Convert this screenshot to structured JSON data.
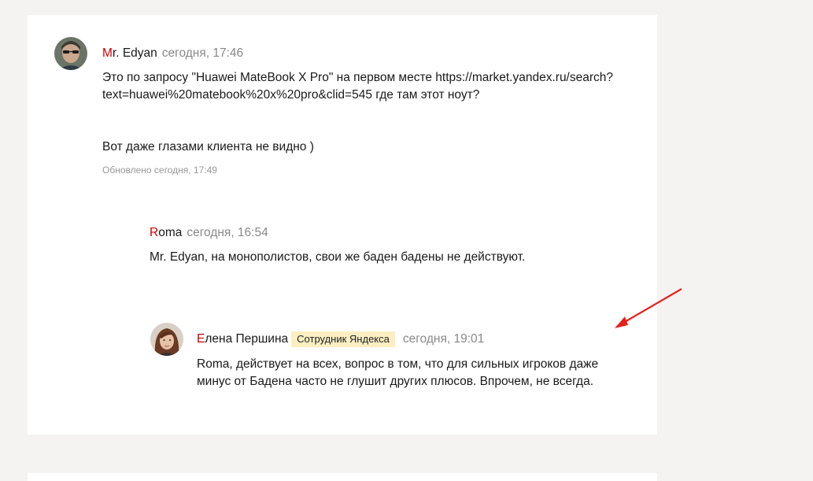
{
  "comments": [
    {
      "author_first": "M",
      "author_rest": "r. Edyan",
      "time": "сегодня, 17:46",
      "line1": "Это по запросу \"Huawei MateBook X Pro\" на первом месте https://market.yandex.ru/search?",
      "line2": "text=huawei%20matebook%20x%20pro&clid=545 где там этот ноут?",
      "line3": "Вот даже глазами клиента не видно )",
      "updated": "Обновлено сегодня, 17:49"
    },
    {
      "author_first": "R",
      "author_rest": "oma",
      "time": "сегодня, 16:54",
      "mention": "Mr. Edyan",
      "text": ", на монополистов, свои же баден бадены не действуют."
    },
    {
      "author_first": "Е",
      "author_rest": "лена Першина",
      "badge": "Сотрудник Яндекса",
      "time": "сегодня, 19:01",
      "mention": "Roma",
      "line1": ", действует на всех, вопрос в том, что для сильных игроков даже",
      "line2": "минус от Бадена часто не глушит других плюсов. Впрочем, не всегда."
    }
  ],
  "colors": {
    "accent_letter": "#cc0000",
    "badge_bg": "#fbefc1",
    "arrow": "#e8201c"
  }
}
